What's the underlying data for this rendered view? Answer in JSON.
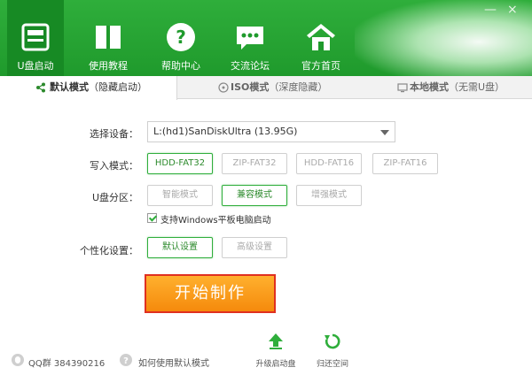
{
  "nav": [
    {
      "label": "U盘启动",
      "icon": "usb-drive-icon"
    },
    {
      "label": "使用教程",
      "icon": "book-icon"
    },
    {
      "label": "帮助中心",
      "icon": "help-icon"
    },
    {
      "label": "交流论坛",
      "icon": "chat-icon"
    },
    {
      "label": "官方首页",
      "icon": "home-icon"
    }
  ],
  "window": {
    "minimize": "—",
    "close": "×"
  },
  "tabs": [
    {
      "label": "默认模式",
      "sub": "（隐藏启动）",
      "icon": "share-icon"
    },
    {
      "label": "ISO模式",
      "sub": "（深度隐藏）",
      "icon": "disc-icon"
    },
    {
      "label": "本地模式",
      "sub": "（无需U盘）",
      "icon": "monitor-icon"
    }
  ],
  "form": {
    "device_label": "选择设备：",
    "device_value": "L:(hd1)SanDiskUltra (13.95G)",
    "write_label": "写入模式：",
    "write_options": [
      "HDD-FAT32",
      "ZIP-FAT32",
      "HDD-FAT16",
      "ZIP-FAT16"
    ],
    "write_selected": "HDD-FAT32",
    "partition_label": "U盘分区：",
    "partition_options": [
      "智能模式",
      "兼容模式",
      "增强模式"
    ],
    "partition_selected": "兼容模式",
    "checkbox_label": "支持Windows平板电脑启动",
    "checkbox_checked": true,
    "personal_label": "个性化设置：",
    "personal_options": [
      "默认设置",
      "高级设置"
    ],
    "personal_selected": "默认设置"
  },
  "start_button": "开始制作",
  "footer": {
    "qq": "QQ群 384390216",
    "help_link": "如何使用默认模式",
    "upgrade": "升级启动盘",
    "restore": "归还空间"
  },
  "colors": {
    "brand_green": "#2fae3b",
    "accent_orange": "#f58a0c",
    "highlight_red": "#e03020"
  }
}
